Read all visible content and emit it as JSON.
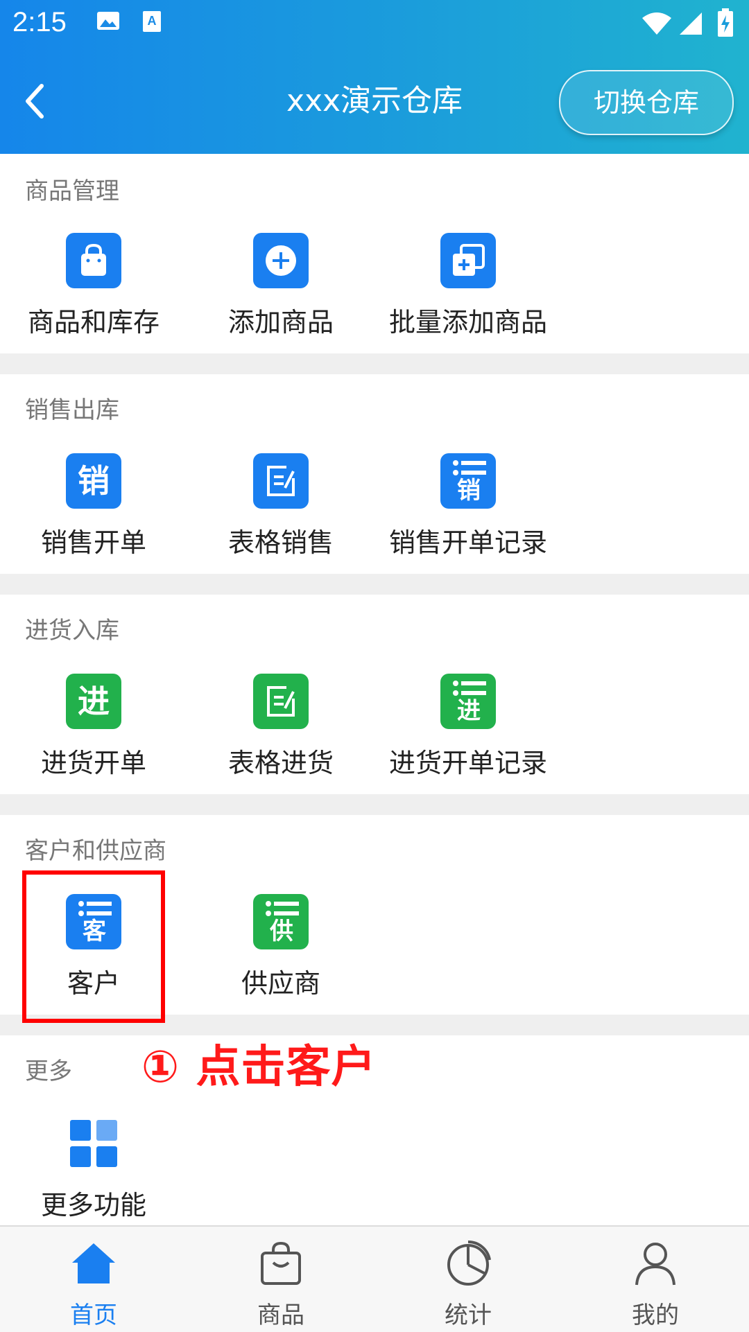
{
  "status_bar": {
    "time": "2:15"
  },
  "header": {
    "title": "xxx演示仓库",
    "switch_label": "切换仓库"
  },
  "sections": [
    {
      "title": "商品管理",
      "items": [
        {
          "label": "商品和库存",
          "icon": "shopping-bag-icon",
          "color": "#1a7ff0"
        },
        {
          "label": "添加商品",
          "icon": "plus-circle-icon",
          "color": "#1a7ff0"
        },
        {
          "label": "批量添加商品",
          "icon": "batch-add-icon",
          "color": "#1a7ff0"
        }
      ]
    },
    {
      "title": "销售出库",
      "items": [
        {
          "label": "销售开单",
          "icon": "sales-icon",
          "glyph": "销",
          "color": "#1a7ff0"
        },
        {
          "label": "表格销售",
          "icon": "edit-sheet-icon",
          "color": "#1a7ff0"
        },
        {
          "label": "销售开单记录",
          "icon": "sales-record-icon",
          "glyph": "销",
          "color": "#1a7ff0"
        }
      ]
    },
    {
      "title": "进货入库",
      "items": [
        {
          "label": "进货开单",
          "icon": "purchase-icon",
          "glyph": "进",
          "color": "#22b14c"
        },
        {
          "label": "表格进货",
          "icon": "edit-sheet-icon",
          "color": "#22b14c"
        },
        {
          "label": "进货开单记录",
          "icon": "purchase-record-icon",
          "glyph": "进",
          "color": "#22b14c"
        }
      ]
    },
    {
      "title": "客户和供应商",
      "items": [
        {
          "label": "客户",
          "icon": "customer-list-icon",
          "glyph": "客",
          "color": "#1a7ff0"
        },
        {
          "label": "供应商",
          "icon": "supplier-list-icon",
          "glyph": "供",
          "color": "#22b14c"
        }
      ]
    },
    {
      "title": "更多",
      "items": [
        {
          "label": "更多功能",
          "icon": "grid-icon",
          "color": "#1a7ff0"
        }
      ]
    }
  ],
  "annotation": "① 点击客户",
  "bottom_nav": [
    {
      "label": "首页",
      "icon": "home-icon",
      "active": true
    },
    {
      "label": "商品",
      "icon": "bag-icon",
      "active": false
    },
    {
      "label": "统计",
      "icon": "pie-chart-icon",
      "active": false
    },
    {
      "label": "我的",
      "icon": "user-icon",
      "active": false
    }
  ],
  "colors": {
    "accent": "#1a7ff0",
    "green": "#22b14c",
    "annotation": "#ff0000"
  }
}
